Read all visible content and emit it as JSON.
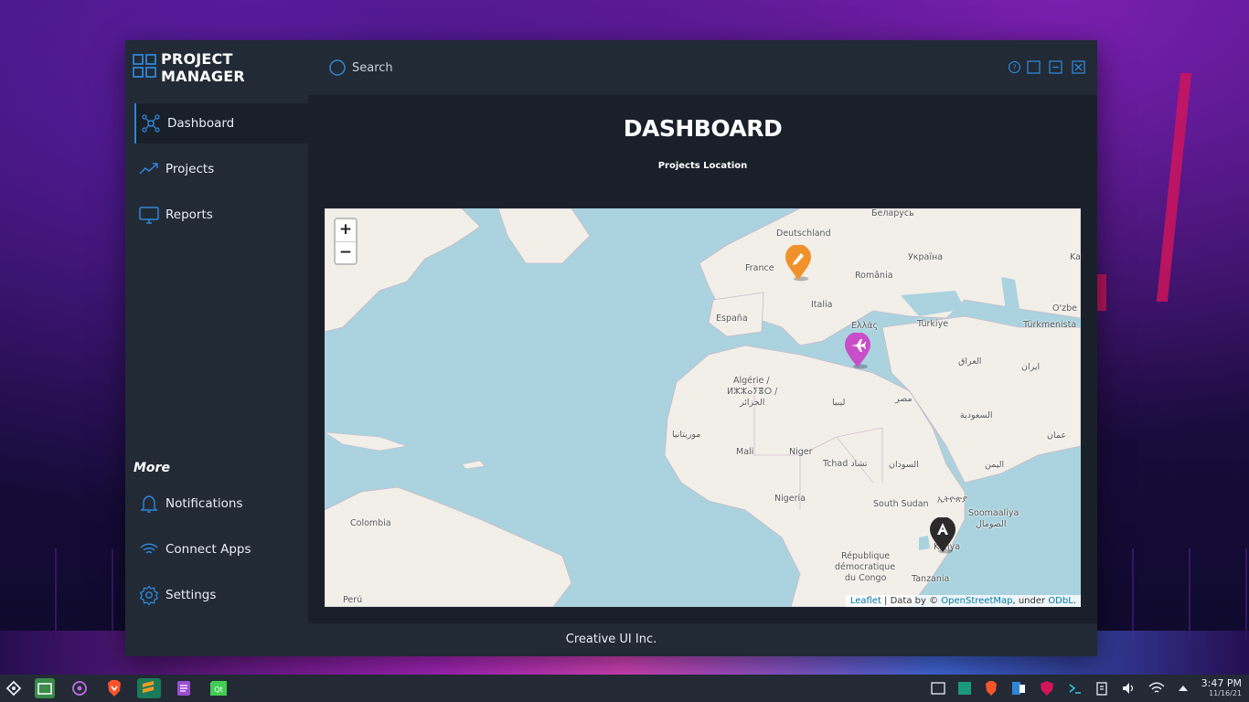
{
  "app": {
    "title": "PROJECT MANAGER",
    "accent": "#2f86d6"
  },
  "sidebar": {
    "items": [
      {
        "label": "Dashboard",
        "icon": "dashboard-icon",
        "active": true
      },
      {
        "label": "Projects",
        "icon": "trend-icon"
      },
      {
        "label": "Reports",
        "icon": "monitor-icon"
      }
    ],
    "more_heading": "More",
    "more_items": [
      {
        "label": "Notifications",
        "icon": "bell-icon"
      },
      {
        "label": "Connect Apps",
        "icon": "wifi-icon"
      },
      {
        "label": "Settings",
        "icon": "gear-icon"
      }
    ]
  },
  "topbar": {
    "search_placeholder": "Search",
    "window_controls": [
      "help-icon",
      "maximize-icon",
      "minimize-icon",
      "close-icon"
    ]
  },
  "main": {
    "title": "DASHBOARD",
    "subtitle": "Projects Location"
  },
  "map": {
    "zoom_in": "+",
    "zoom_out": "−",
    "attribution": {
      "leaflet": "Leaflet",
      "sep1": " | Data by © ",
      "osm": "OpenStreetMap",
      "sep2": ", under ",
      "license": "ODbL",
      "end": "."
    },
    "labels": [
      "Беларусь",
      "Deutschland",
      "Україна",
      "France",
      "România",
      "Italia",
      "España",
      "Ελλάς",
      "Türkiye",
      "Türkmenista",
      "O'zbe",
      "Algérie /",
      "ⵍⵣⵣⴰⵢⴻⵔ /",
      "الجزائر",
      "ليبيا",
      "مصر",
      "العراق",
      "ایران",
      "السعودية",
      "عمان",
      "موريتانيا",
      "Mali",
      "Niger",
      "Tchad تشاد",
      "السودان",
      "اليمن",
      "Nigeria",
      "South Sudan",
      "ኢትዮጵያ",
      "Soomaaliya",
      "الصومال",
      "Kenya",
      "République",
      "démocratique",
      "du Congo",
      "Tanzania",
      "Colombia",
      "Perú",
      "Ka"
    ],
    "markers": [
      {
        "name": "Italy project",
        "color": "#f0922b",
        "icon": "pencil-icon"
      },
      {
        "name": "Libya project",
        "color": "#c94ec9",
        "icon": "plane-icon"
      },
      {
        "name": "Kenya project",
        "color": "#2b2b2b",
        "icon": "a-icon"
      }
    ]
  },
  "footer": {
    "text": "Creative UI Inc."
  },
  "taskbar": {
    "time": "3:47 PM",
    "date": "11/16/21"
  }
}
